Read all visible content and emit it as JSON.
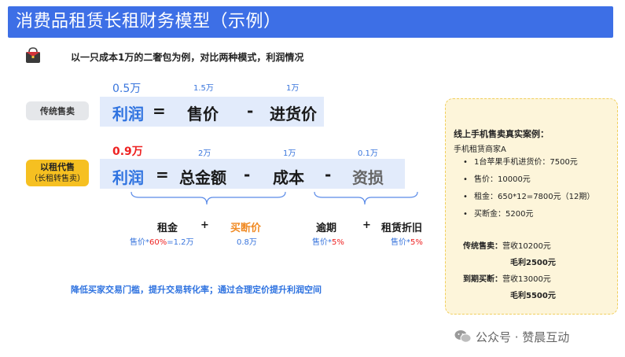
{
  "header": {
    "title": "消费品租赁长租财务模型（示例）"
  },
  "intro": "以一只成本1万的二奢包为例，对比两种模式，利润情况",
  "traditional": {
    "label": "传统售卖",
    "profit_value": "0.5万",
    "price_value": "1.5万",
    "cost_value": "1万",
    "profit_word": "利润",
    "eq": "=",
    "price_word": "售价",
    "minus": "-",
    "cost_word": "进货价"
  },
  "rental": {
    "label": "以租代售",
    "label_sub": "（长租转售卖）",
    "profit_value": "0.9万",
    "total_value": "2万",
    "cost_value": "1万",
    "loss_value": "0.1万",
    "profit_word": "利润",
    "eq": "=",
    "total_word": "总金额",
    "minus1": "-",
    "cost_word": "成本",
    "minus2": "-",
    "loss_word": "资损"
  },
  "breakdown": {
    "rent": "租金",
    "plus1": "+",
    "buyout": "买断价",
    "rent_note_a": "售价*",
    "rent_note_pct": "60%",
    "rent_note_b": "=1.2万",
    "buyout_note": "0.8万",
    "overdue": "逾期",
    "plus2": "+",
    "depreciation": "租赁折旧",
    "overdue_note_a": "售价*",
    "overdue_note_pct": "5%",
    "dep_note_a": "售价*",
    "dep_note_pct": "5%"
  },
  "bottom_note": "降低买家交易门槛，提升交易转化率；通过合理定价提升利润空间",
  "case": {
    "title": "线上手机售卖真实案例：",
    "merchant": "手机租赁商家A",
    "items": [
      "1台苹果手机进货价：7500元",
      "售价：10000元",
      "租金：650*12=7800元（12期）",
      "买断金：5200元"
    ],
    "trad_label": "传统售卖：",
    "trad_revenue": "营收10200元",
    "trad_profit": "毛利2500元",
    "buyout_label": "到期买断：",
    "buyout_revenue": "营收13000元",
    "buyout_profit": "毛利5500元"
  },
  "watermark": "公众号 · 赞晨互动",
  "icons": {
    "bag": "handbag-icon",
    "wechat": "wechat-icon"
  },
  "colors": {
    "title_bg": "#3d6fe6",
    "accent_blue": "#2f73e0",
    "highlight_red": "#e22222",
    "orange": "#f08a24",
    "label_yellow": "#f6c021"
  }
}
